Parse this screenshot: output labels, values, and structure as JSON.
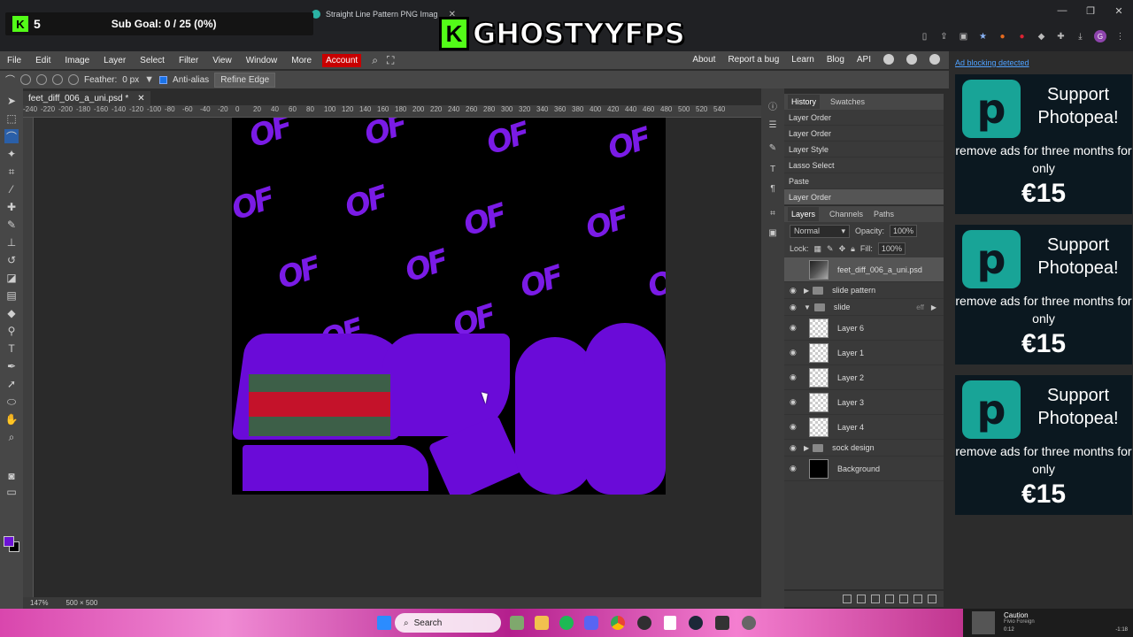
{
  "browser": {
    "tab_title": "Straight Line Pattern PNG Imag",
    "window_controls": [
      "—",
      "❐",
      "✕"
    ]
  },
  "overlay": {
    "kick_count": "5",
    "sub_goal": "Sub Goal: 0 / 25 (0%)",
    "brand_logo_letter": "K",
    "brand_name": "GHOSTYYFPS"
  },
  "menubar": {
    "items": [
      "File",
      "Edit",
      "Image",
      "Layer",
      "Select",
      "Filter",
      "View",
      "Window",
      "More"
    ],
    "account": "Account",
    "right_items": [
      "About",
      "Report a bug",
      "Learn",
      "Blog",
      "API"
    ]
  },
  "options": {
    "feather_label": "Feather:",
    "feather_value": "0 px",
    "antialias_label": "Anti-alias",
    "refine_edge": "Refine Edge"
  },
  "document": {
    "tab_name": "feet_diff_006_a_uni.psd *",
    "zoom": "147%",
    "size": "500 × 500",
    "ruler_labels": [
      "-240",
      "-220",
      "-200",
      "-180",
      "-160",
      "-140",
      "-120",
      "-100",
      "-80",
      "-60",
      "-40",
      "-20",
      "0",
      "20",
      "40",
      "60",
      "80",
      "100",
      "120",
      "140",
      "160",
      "180",
      "200",
      "220",
      "240",
      "260",
      "280",
      "300",
      "320",
      "340",
      "360",
      "380",
      "400",
      "420",
      "440",
      "460",
      "480",
      "500",
      "520",
      "540"
    ],
    "pattern_text": "OF"
  },
  "history": {
    "tabs": [
      "History",
      "Swatches"
    ],
    "items": [
      "Layer Order",
      "Layer Order",
      "Layer Style",
      "Lasso Select",
      "Paste",
      "Layer Order"
    ]
  },
  "layers": {
    "tabs": [
      "Layers",
      "Channels",
      "Paths"
    ],
    "blend_mode": "Normal",
    "opacity_label": "Opacity:",
    "opacity": "100%",
    "lock_label": "Lock:",
    "fill_label": "Fill:",
    "fill": "100%",
    "rows": [
      {
        "name": "feet_diff_006_a_uni.psd",
        "kind": "layer",
        "thumb": "pattern",
        "selected": true
      },
      {
        "name": "slide pattern",
        "kind": "group",
        "expanded": false
      },
      {
        "name": "slide",
        "kind": "group",
        "expanded": true,
        "fx": "eff"
      },
      {
        "name": "Layer 6",
        "kind": "layer",
        "thumb": "transparent"
      },
      {
        "name": "Layer 1",
        "kind": "layer",
        "thumb": "transparent"
      },
      {
        "name": "Layer 2",
        "kind": "layer",
        "thumb": "transparent"
      },
      {
        "name": "Layer 3",
        "kind": "layer",
        "thumb": "transparent"
      },
      {
        "name": "Layer 4",
        "kind": "layer",
        "thumb": "transparent"
      },
      {
        "name": "sock design",
        "kind": "group",
        "expanded": false
      },
      {
        "name": "Background",
        "kind": "layer",
        "thumb": "black"
      }
    ]
  },
  "ads": {
    "header": "Ad blocking detected",
    "logo_letter": "p",
    "title": "Support Photopea!",
    "body": "remove ads for three months for only",
    "price": "€15"
  },
  "taskbar": {
    "search": "Search",
    "media_title": "Caution",
    "media_artist": "Fivio Foreign",
    "media_elapsed": "0:12",
    "media_remaining": "-1:18"
  },
  "colors": {
    "accent_purple": "#6a0bd8",
    "kick_green": "#53fc18",
    "account_red": "#c80000",
    "photopea_teal": "#18a497"
  }
}
